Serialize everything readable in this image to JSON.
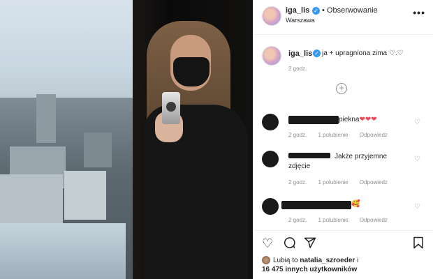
{
  "header": {
    "username": "iga_lis",
    "follow_label": "• Obserwowanie",
    "location": "Warszawa",
    "more_icon": "more-dots-icon"
  },
  "caption": {
    "username": "iga_lis",
    "text": "ja + upragniona zima ♡.♡",
    "time": "2 godz."
  },
  "comments": [
    {
      "text_visible": "piekna",
      "emoji": "❤❤❤",
      "time": "2 godz.",
      "likes": "1 polubienie",
      "reply": "Odpowiedz"
    },
    {
      "text_visible_1": "Jakże przyjemne",
      "text_visible_2": "zdjęcie",
      "time": "2 godz.",
      "likes": "1 polubienie",
      "reply": "Odpowiedz"
    },
    {
      "emoji": "🥰",
      "time": "2 godz.",
      "likes": "1 polubienie",
      "reply": "Odpowiedz"
    }
  ],
  "actions": {
    "like_icon": "heart-icon",
    "comment_icon": "comment-icon",
    "share_icon": "share-icon",
    "save_icon": "bookmark-icon"
  },
  "likes": {
    "prefix": "Lubią to ",
    "user": "natalia_szroeder",
    "suffix": " i",
    "count": "16 475 innych użytkowników"
  },
  "colors": {
    "verified": "#3897f0",
    "heart_red": "#ed4956",
    "meta_gray": "#8e8e8e"
  }
}
